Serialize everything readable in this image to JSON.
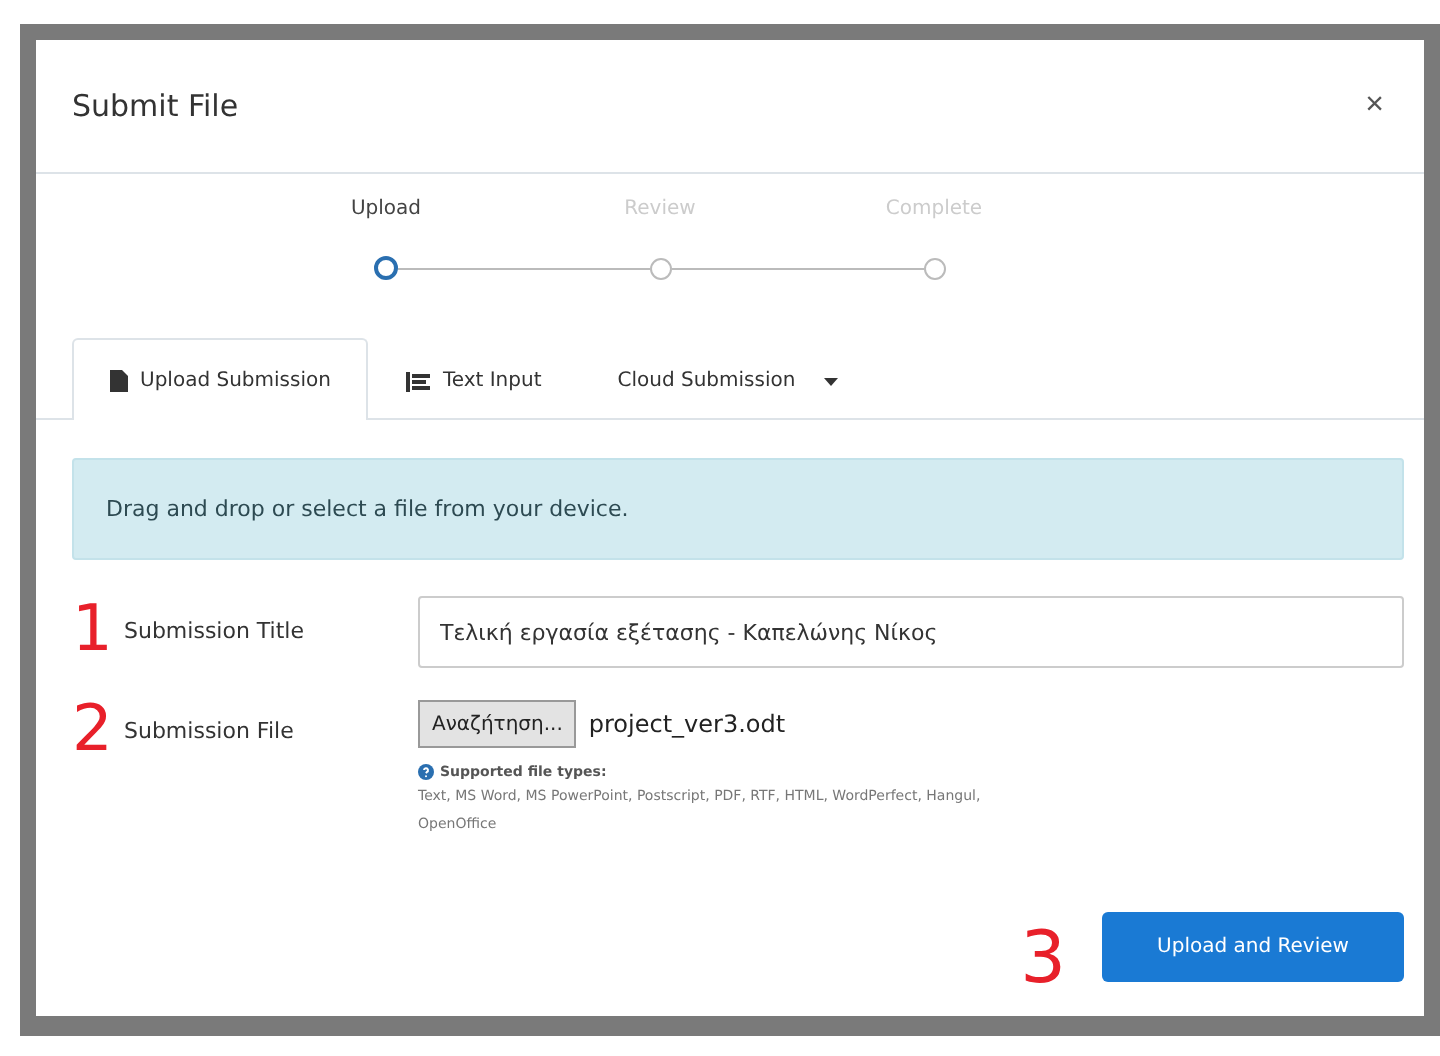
{
  "dialog": {
    "title": "Submit File",
    "close": "×"
  },
  "steps": [
    {
      "label": "Upload",
      "selected": true
    },
    {
      "label": "Review",
      "selected": false
    },
    {
      "label": "Complete",
      "selected": false
    }
  ],
  "tabs": [
    {
      "label": "Upload Submission",
      "kind": "document",
      "selected": true
    },
    {
      "label": "Text Input",
      "kind": "text",
      "selected": false
    },
    {
      "label": "Cloud Submission",
      "kind": "menu",
      "selected": false
    }
  ],
  "alert": "Drag and drop or select a file from your device.",
  "fields": [
    {
      "marker": "1",
      "label": "Submission Title",
      "kind": "text",
      "value": "Τελική εργασία εξέτασης - Καπελώνης Νίκος"
    },
    {
      "marker": "2",
      "label": "Submission File",
      "kind": "file",
      "button": "Αναζήτηση...",
      "value": "project_ver3.odt",
      "help_title": "Supported file types:",
      "help_text": "Text, MS Word, MS PowerPoint, Postscript, PDF, RTF, HTML, WordPerfect, Hangul, OpenOffice"
    }
  ],
  "footer": {
    "marker": "3",
    "button": "Upload and Review"
  }
}
